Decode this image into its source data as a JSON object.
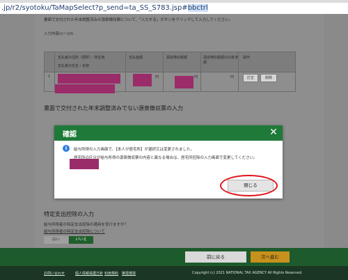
{
  "browser": {
    "url_prefix": ".jp/r2/syotoku/TaMapSelect?p_send=ta_SS_S783.jsp#",
    "url_hash": "bbctrl"
  },
  "page": {
    "intro_text": "書面で交付された年末調整済みの源泉徴収票について、「入力する」ボタンをクリックして入力してください。",
    "table_caption": "入力内容(1～10)",
    "table": {
      "headers": {
        "payer_address": "支払者の住所（居所）・所在地",
        "payer_name": "支払者の氏名・名称",
        "amount": "支払金額",
        "withholding": "源泉徴収税額",
        "internal": "源泉徴収税額の内未済額",
        "ops": "操作"
      },
      "row_index": "1",
      "yen": "円",
      "edit_label": "訂正",
      "delete_label": "削除"
    },
    "section_untreated": "書面で交付された年末調整済みでない源泉徴収票の入力",
    "section_specific": "特定支出控除の入力",
    "specific_question": "給与所得者の特定支出控除の適用を受けますか？",
    "specific_link": "給与所得者の特定支出控除について",
    "yes_label": "はい",
    "no_label": "いいえ"
  },
  "modal": {
    "title": "確認",
    "close_icon": "✕",
    "info_icon": "i",
    "line1": "給与所得の入力画面で、【本人が居宅所】が選択又は変更されました。",
    "line2": "居宅所の区分が給与所得の源泉徴収票の内容と異なる場合は、居宅所控除の入力画面で変更してください。",
    "close_button": "閉じる"
  },
  "footer": {
    "back_label": "前に戻る",
    "next_label": "次へ進む",
    "links": [
      "お問い合わせ",
      "個人情報保護方針",
      "利用規約",
      "推奨環境"
    ],
    "copyright": "Copyright (c) 2021 NATIONAL TAX AGENCY All Rights Reserved."
  },
  "colors": {
    "header_green": "#1f7a3a",
    "next_button": "#c8901c",
    "annotation_red": "#e0141b",
    "redaction": "#9a2c6a"
  }
}
